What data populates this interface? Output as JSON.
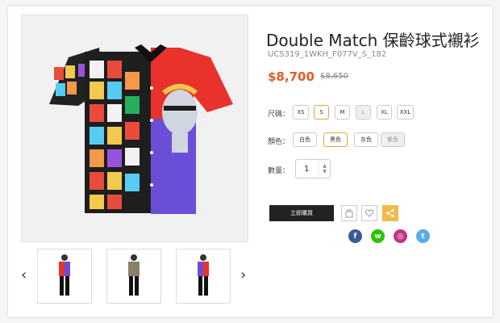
{
  "product": {
    "title": "Double Match 保齡球式襯衫",
    "sku": "UCS319_1WKH_F077V_S_182",
    "price": "$8,700",
    "old_price": "$8,650"
  },
  "size": {
    "label": "尺碼：",
    "options": [
      "XS",
      "S",
      "M",
      "L",
      "XL",
      "XXL"
    ],
    "selected": "S",
    "disabled": [
      "L"
    ]
  },
  "color": {
    "label": "顏色：",
    "options": [
      "白色",
      "黑色",
      "灰色",
      "紫色"
    ],
    "selected": "黑色",
    "disabled": [
      "紫色"
    ]
  },
  "quantity": {
    "label": "數量：",
    "value": "1"
  },
  "actions": {
    "buy_label": "立即購買"
  },
  "thumbnails": {
    "prev_arrow": "‹",
    "next_arrow": "›"
  },
  "social": {
    "facebook": "f",
    "wechat": "w",
    "instagram": "◎",
    "twitter": "t"
  },
  "colors": {
    "accent": "#e55b25",
    "selected_border": "#e8a23b",
    "share_bg": "#f0b948",
    "facebook": "#3b5998",
    "wechat": "#2dc100",
    "instagram": "#c13584",
    "twitter": "#55acee"
  }
}
